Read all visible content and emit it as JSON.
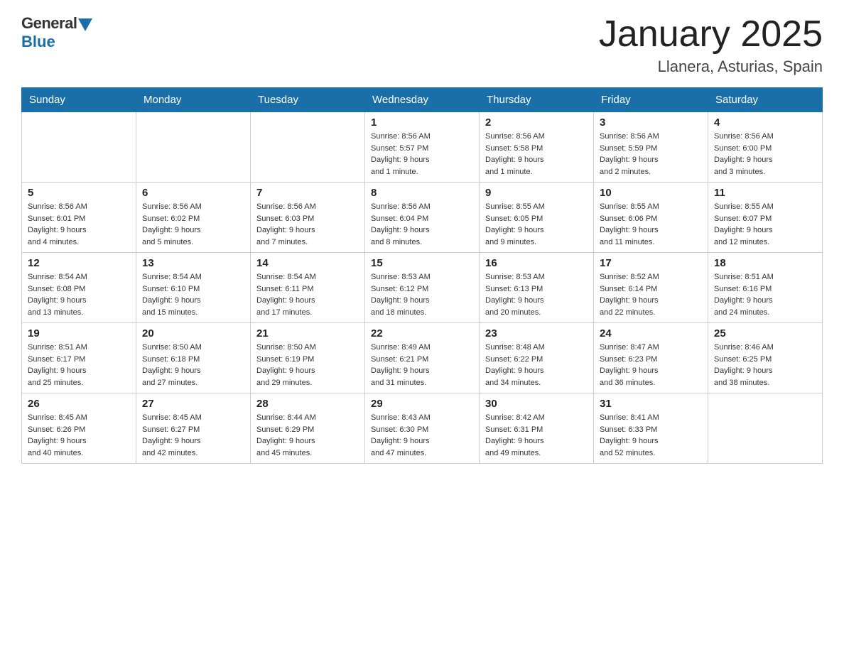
{
  "logo": {
    "general": "General",
    "blue": "Blue"
  },
  "title": "January 2025",
  "subtitle": "Llanera, Asturias, Spain",
  "days_of_week": [
    "Sunday",
    "Monday",
    "Tuesday",
    "Wednesday",
    "Thursday",
    "Friday",
    "Saturday"
  ],
  "weeks": [
    [
      {
        "day": "",
        "info": ""
      },
      {
        "day": "",
        "info": ""
      },
      {
        "day": "",
        "info": ""
      },
      {
        "day": "1",
        "info": "Sunrise: 8:56 AM\nSunset: 5:57 PM\nDaylight: 9 hours\nand 1 minute."
      },
      {
        "day": "2",
        "info": "Sunrise: 8:56 AM\nSunset: 5:58 PM\nDaylight: 9 hours\nand 1 minute."
      },
      {
        "day": "3",
        "info": "Sunrise: 8:56 AM\nSunset: 5:59 PM\nDaylight: 9 hours\nand 2 minutes."
      },
      {
        "day": "4",
        "info": "Sunrise: 8:56 AM\nSunset: 6:00 PM\nDaylight: 9 hours\nand 3 minutes."
      }
    ],
    [
      {
        "day": "5",
        "info": "Sunrise: 8:56 AM\nSunset: 6:01 PM\nDaylight: 9 hours\nand 4 minutes."
      },
      {
        "day": "6",
        "info": "Sunrise: 8:56 AM\nSunset: 6:02 PM\nDaylight: 9 hours\nand 5 minutes."
      },
      {
        "day": "7",
        "info": "Sunrise: 8:56 AM\nSunset: 6:03 PM\nDaylight: 9 hours\nand 7 minutes."
      },
      {
        "day": "8",
        "info": "Sunrise: 8:56 AM\nSunset: 6:04 PM\nDaylight: 9 hours\nand 8 minutes."
      },
      {
        "day": "9",
        "info": "Sunrise: 8:55 AM\nSunset: 6:05 PM\nDaylight: 9 hours\nand 9 minutes."
      },
      {
        "day": "10",
        "info": "Sunrise: 8:55 AM\nSunset: 6:06 PM\nDaylight: 9 hours\nand 11 minutes."
      },
      {
        "day": "11",
        "info": "Sunrise: 8:55 AM\nSunset: 6:07 PM\nDaylight: 9 hours\nand 12 minutes."
      }
    ],
    [
      {
        "day": "12",
        "info": "Sunrise: 8:54 AM\nSunset: 6:08 PM\nDaylight: 9 hours\nand 13 minutes."
      },
      {
        "day": "13",
        "info": "Sunrise: 8:54 AM\nSunset: 6:10 PM\nDaylight: 9 hours\nand 15 minutes."
      },
      {
        "day": "14",
        "info": "Sunrise: 8:54 AM\nSunset: 6:11 PM\nDaylight: 9 hours\nand 17 minutes."
      },
      {
        "day": "15",
        "info": "Sunrise: 8:53 AM\nSunset: 6:12 PM\nDaylight: 9 hours\nand 18 minutes."
      },
      {
        "day": "16",
        "info": "Sunrise: 8:53 AM\nSunset: 6:13 PM\nDaylight: 9 hours\nand 20 minutes."
      },
      {
        "day": "17",
        "info": "Sunrise: 8:52 AM\nSunset: 6:14 PM\nDaylight: 9 hours\nand 22 minutes."
      },
      {
        "day": "18",
        "info": "Sunrise: 8:51 AM\nSunset: 6:16 PM\nDaylight: 9 hours\nand 24 minutes."
      }
    ],
    [
      {
        "day": "19",
        "info": "Sunrise: 8:51 AM\nSunset: 6:17 PM\nDaylight: 9 hours\nand 25 minutes."
      },
      {
        "day": "20",
        "info": "Sunrise: 8:50 AM\nSunset: 6:18 PM\nDaylight: 9 hours\nand 27 minutes."
      },
      {
        "day": "21",
        "info": "Sunrise: 8:50 AM\nSunset: 6:19 PM\nDaylight: 9 hours\nand 29 minutes."
      },
      {
        "day": "22",
        "info": "Sunrise: 8:49 AM\nSunset: 6:21 PM\nDaylight: 9 hours\nand 31 minutes."
      },
      {
        "day": "23",
        "info": "Sunrise: 8:48 AM\nSunset: 6:22 PM\nDaylight: 9 hours\nand 34 minutes."
      },
      {
        "day": "24",
        "info": "Sunrise: 8:47 AM\nSunset: 6:23 PM\nDaylight: 9 hours\nand 36 minutes."
      },
      {
        "day": "25",
        "info": "Sunrise: 8:46 AM\nSunset: 6:25 PM\nDaylight: 9 hours\nand 38 minutes."
      }
    ],
    [
      {
        "day": "26",
        "info": "Sunrise: 8:45 AM\nSunset: 6:26 PM\nDaylight: 9 hours\nand 40 minutes."
      },
      {
        "day": "27",
        "info": "Sunrise: 8:45 AM\nSunset: 6:27 PM\nDaylight: 9 hours\nand 42 minutes."
      },
      {
        "day": "28",
        "info": "Sunrise: 8:44 AM\nSunset: 6:29 PM\nDaylight: 9 hours\nand 45 minutes."
      },
      {
        "day": "29",
        "info": "Sunrise: 8:43 AM\nSunset: 6:30 PM\nDaylight: 9 hours\nand 47 minutes."
      },
      {
        "day": "30",
        "info": "Sunrise: 8:42 AM\nSunset: 6:31 PM\nDaylight: 9 hours\nand 49 minutes."
      },
      {
        "day": "31",
        "info": "Sunrise: 8:41 AM\nSunset: 6:33 PM\nDaylight: 9 hours\nand 52 minutes."
      },
      {
        "day": "",
        "info": ""
      }
    ]
  ]
}
